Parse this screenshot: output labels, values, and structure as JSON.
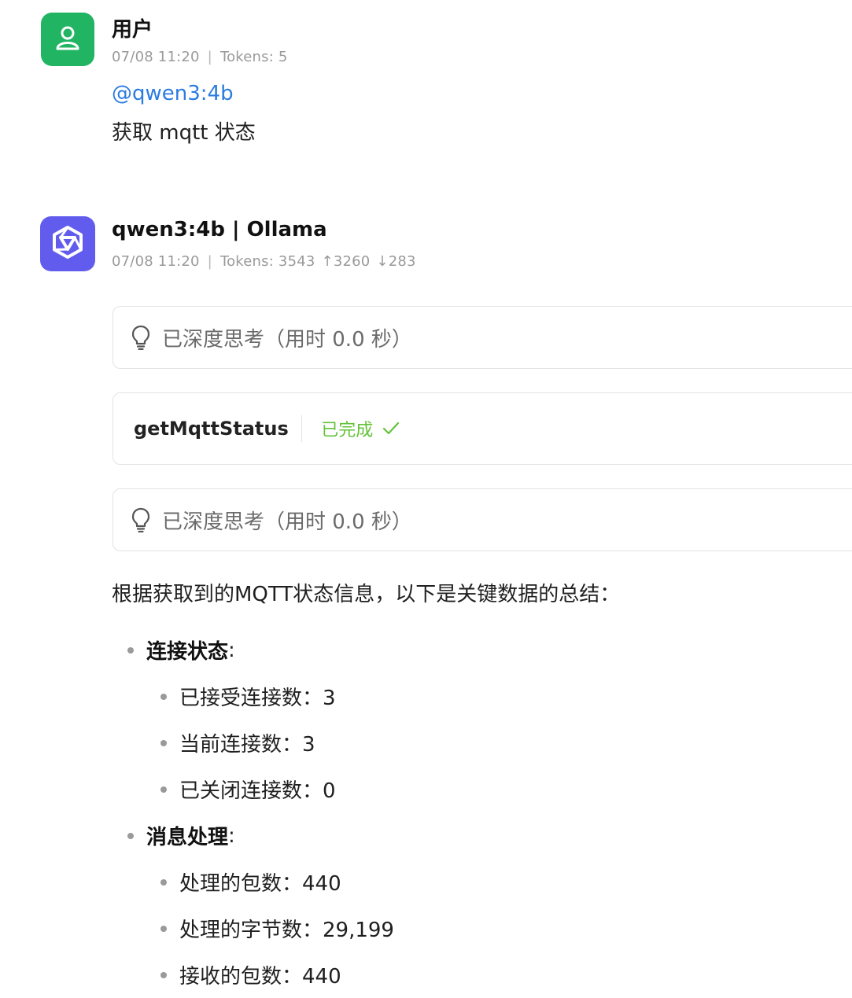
{
  "user": {
    "name": "用户",
    "date": "07/08 11:20",
    "tokens": "Tokens: 5",
    "mention": "@qwen3:4b",
    "message": "获取 mqtt 状态",
    "avatar_color": "#20b463",
    "avatar_icon": "user-icon"
  },
  "assistant": {
    "name": "qwen3:4b | Ollama",
    "date": "07/08 11:20",
    "tokens": "Tokens: 3543",
    "tokens_up": "↑3260",
    "tokens_down": "↓283",
    "avatar_color": "#615ced",
    "avatar_icon": "qwen-logo-icon"
  },
  "thinking_1": {
    "text": "已深度思考（用时 0.0 秒）",
    "icon": "lightbulb-icon"
  },
  "tool_call": {
    "name": "getMqttStatus",
    "status": "已完成",
    "status_color": "#64c23a",
    "icon": "check-icon"
  },
  "thinking_2": {
    "text": "已深度思考（用时 0.0 秒）",
    "icon": "lightbulb-icon"
  },
  "response": {
    "intro": "根据获取到的MQTT状态信息，以下是关键数据的总结：",
    "sections": [
      {
        "title": "连接状态",
        "colon": ":",
        "items": [
          "已接受连接数：3",
          "当前连接数：3",
          "已关闭连接数：0"
        ]
      },
      {
        "title": "消息处理",
        "colon": ":",
        "items": [
          "处理的包数：440",
          "处理的字节数：29,199",
          "接收的包数：440"
        ]
      }
    ]
  },
  "separator": "|"
}
